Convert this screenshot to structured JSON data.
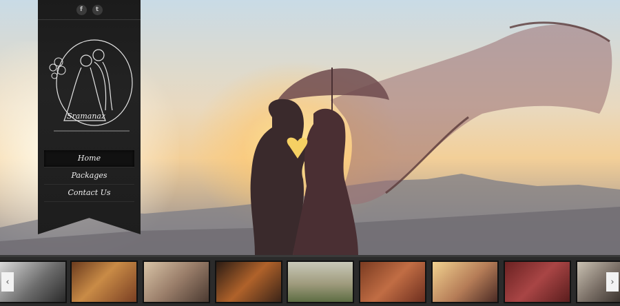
{
  "social": {
    "icons": [
      "facebook-icon",
      "twitter-icon"
    ],
    "facebook_glyph": "f",
    "twitter_glyph": "t"
  },
  "logo": {
    "text": "Sramanaz"
  },
  "nav": {
    "items": [
      {
        "label": "Home",
        "active": true
      },
      {
        "label": "Packages",
        "active": false
      },
      {
        "label": "Contact Us",
        "active": false
      }
    ]
  },
  "gallery": {
    "prev_glyph": "‹",
    "next_glyph": "›",
    "thumbnail_count": 9
  },
  "colors": {
    "ribbon": "#1d1d1d",
    "strip": "#2b2b2b",
    "nav_text": "#f1f1f1"
  }
}
